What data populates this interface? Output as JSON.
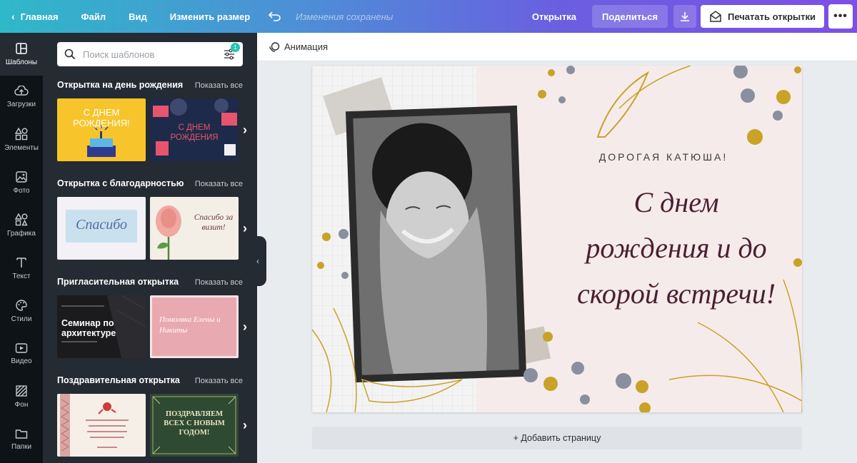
{
  "topbar": {
    "home": "Главная",
    "file": "Файл",
    "view": "Вид",
    "resize": "Изменить размер",
    "saved": "Изменения сохранены",
    "doc_type": "Открытка",
    "share": "Поделиться",
    "print": "Печатать открытки"
  },
  "rail": [
    {
      "label": "Шаблоны",
      "icon": "templates-icon"
    },
    {
      "label": "Загрузки",
      "icon": "upload-icon"
    },
    {
      "label": "Элементы",
      "icon": "elements-icon"
    },
    {
      "label": "Фото",
      "icon": "photo-icon"
    },
    {
      "label": "Графика",
      "icon": "graphics-icon"
    },
    {
      "label": "Текст",
      "icon": "text-icon"
    },
    {
      "label": "Стили",
      "icon": "palette-icon"
    },
    {
      "label": "Видео",
      "icon": "video-icon"
    },
    {
      "label": "Фон",
      "icon": "background-icon"
    },
    {
      "label": "Папки",
      "icon": "folder-icon"
    }
  ],
  "search": {
    "placeholder": "Поиск шаблонов",
    "filter_count": "1"
  },
  "sections": [
    {
      "title": "Открытка на день рождения",
      "show_all": "Показать все",
      "thumbs": [
        {
          "text": "С ДНЕМ РОЖДЕНИЯ!"
        },
        {
          "text": "С ДНЕМ РОЖДЕНИЯ"
        }
      ]
    },
    {
      "title": "Открытка с благодарностью",
      "show_all": "Показать все",
      "thumbs": [
        {
          "text": "Спасибо"
        },
        {
          "text": "Спасибо за визит!"
        }
      ]
    },
    {
      "title": "Пригласительная открытка",
      "show_all": "Показать все",
      "thumbs": [
        {
          "text": "Семинар по архитектуре"
        },
        {
          "text": "Помолвка Елены и Никиты"
        }
      ]
    },
    {
      "title": "Поздравительная открытка",
      "show_all": "Показать все",
      "thumbs": [
        {
          "text": ""
        },
        {
          "text": "ПОЗДРАВЛЯЕМ ВСЕХ С НОВЫМ ГОДОМ!"
        }
      ]
    }
  ],
  "toolbar": {
    "animation": "Анимация"
  },
  "card": {
    "greeting": "ДОРОГАЯ КАТЮША!",
    "line1": "С днем",
    "line2": "рождения и до",
    "line3": "скорой встречи!"
  },
  "add_page": "+ Добавить страницу",
  "colors": {
    "accent_teal": "#2fb8c9",
    "accent_purple": "#7d4fe6",
    "panel": "#252b32",
    "rail": "#0e1318",
    "card_bg": "#f5ebea",
    "script_text": "#4a1f33",
    "gold": "#c9a227"
  }
}
